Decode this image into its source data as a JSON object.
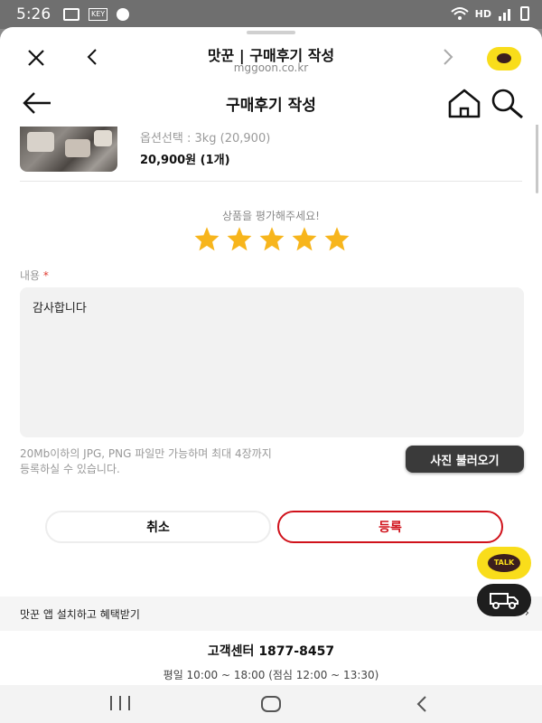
{
  "status_bar": {
    "time": "5:26",
    "hd_label": "HD",
    "key_label": "KEY"
  },
  "browser": {
    "title": "맛꾼 | 구매후기 작성",
    "url": "mggoon.co.kr"
  },
  "header": {
    "title": "구매후기 작성"
  },
  "product": {
    "option": "옵션선택 : 3kg (20,900)",
    "price": "20,900원 (1개)"
  },
  "rating": {
    "prompt": "상품을 평가해주세요!",
    "stars": 5,
    "max": 5,
    "color": "#f7b51c"
  },
  "review": {
    "label": "내용",
    "required_mark": "*",
    "value": "감사합니다"
  },
  "upload": {
    "note_line1": "20Mb이하의 JPG, PNG 파일만 가능하며 최대 4장까지",
    "note_line2": "등록하실 수 있습니다.",
    "button_label": "사진 불러오기"
  },
  "actions": {
    "cancel_label": "취소",
    "submit_label": "등록",
    "accent_color": "#d0121b"
  },
  "floating": {
    "talk_label": "TALK"
  },
  "banner": {
    "text": "맛꾼 앱 설치하고 혜택받기",
    "arrow": "›"
  },
  "customer_center": {
    "title": "고객센터 1877-8457",
    "hours": "평일 10:00 ~ 18:00 (점심 12:00 ~ 13:30)"
  }
}
